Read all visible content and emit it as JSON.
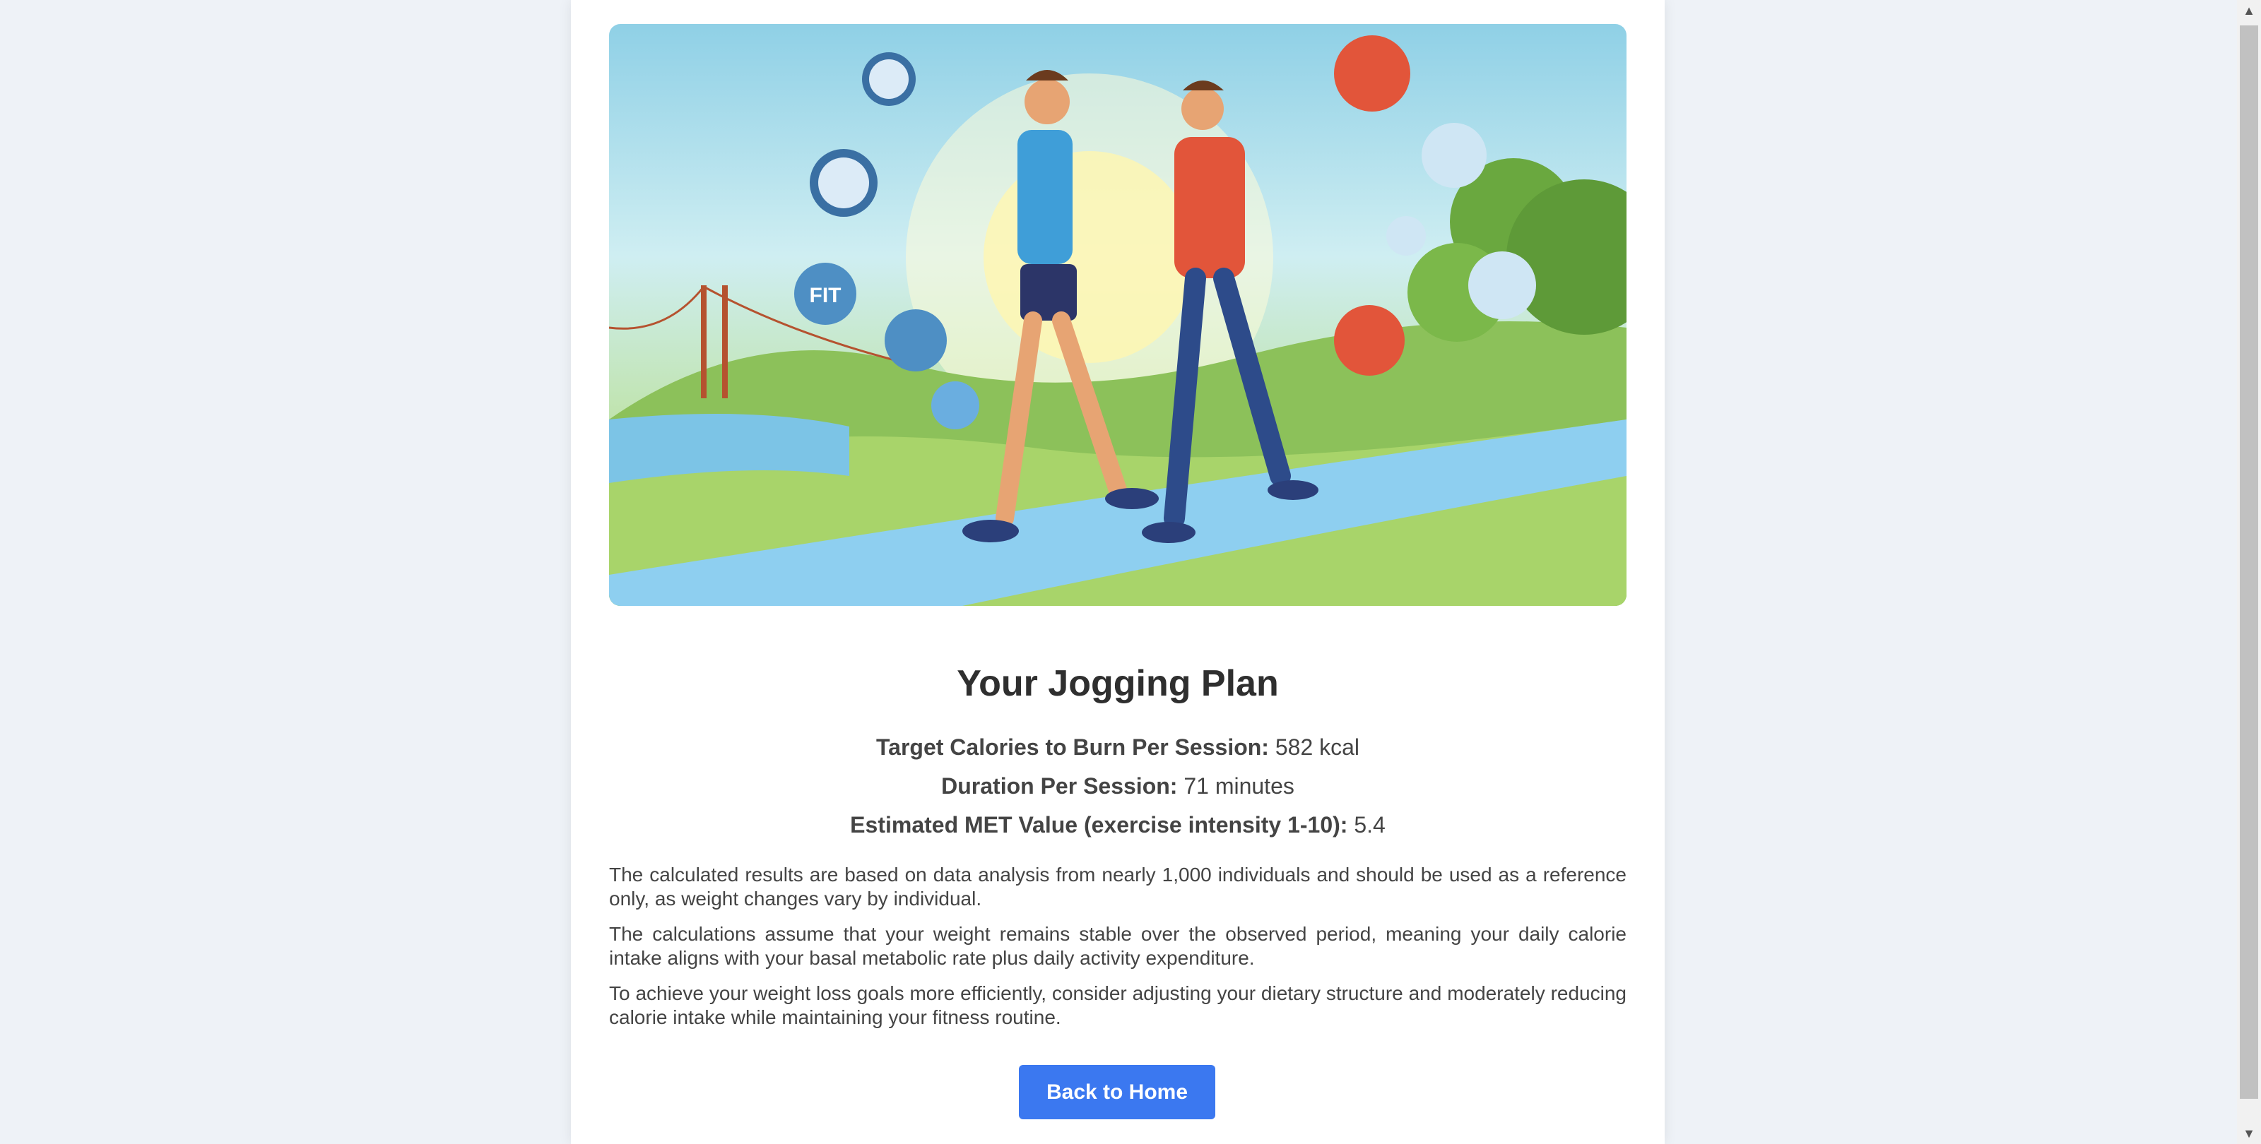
{
  "plan": {
    "title": "Your Jogging Plan",
    "stats": [
      {
        "label": "Target Calories to Burn Per Session:",
        "value": "582 kcal"
      },
      {
        "label": "Duration Per Session:",
        "value": "71 minutes"
      },
      {
        "label": "Estimated MET Value (exercise intensity 1-10):",
        "value": "5.4"
      }
    ],
    "notes": [
      "The calculated results are based on data analysis from nearly 1,000 individuals and should be used as a reference only, as weight changes vary by individual.",
      "The calculations assume that your weight remains stable over the observed period, meaning your daily calorie intake aligns with your basal metabolic rate plus daily activity expenditure.",
      "To achieve your weight loss goals more efficiently, consider adjusting your dietary structure and moderately reducing calorie intake while maintaining your fitness routine."
    ],
    "back_button": "Back to Home"
  },
  "hero": {
    "badge_text": "FIT"
  },
  "colors": {
    "button": "#3b78f0",
    "background": "#eef2f7"
  },
  "icons": {
    "scroll_up": "▲",
    "scroll_down": "▼"
  }
}
